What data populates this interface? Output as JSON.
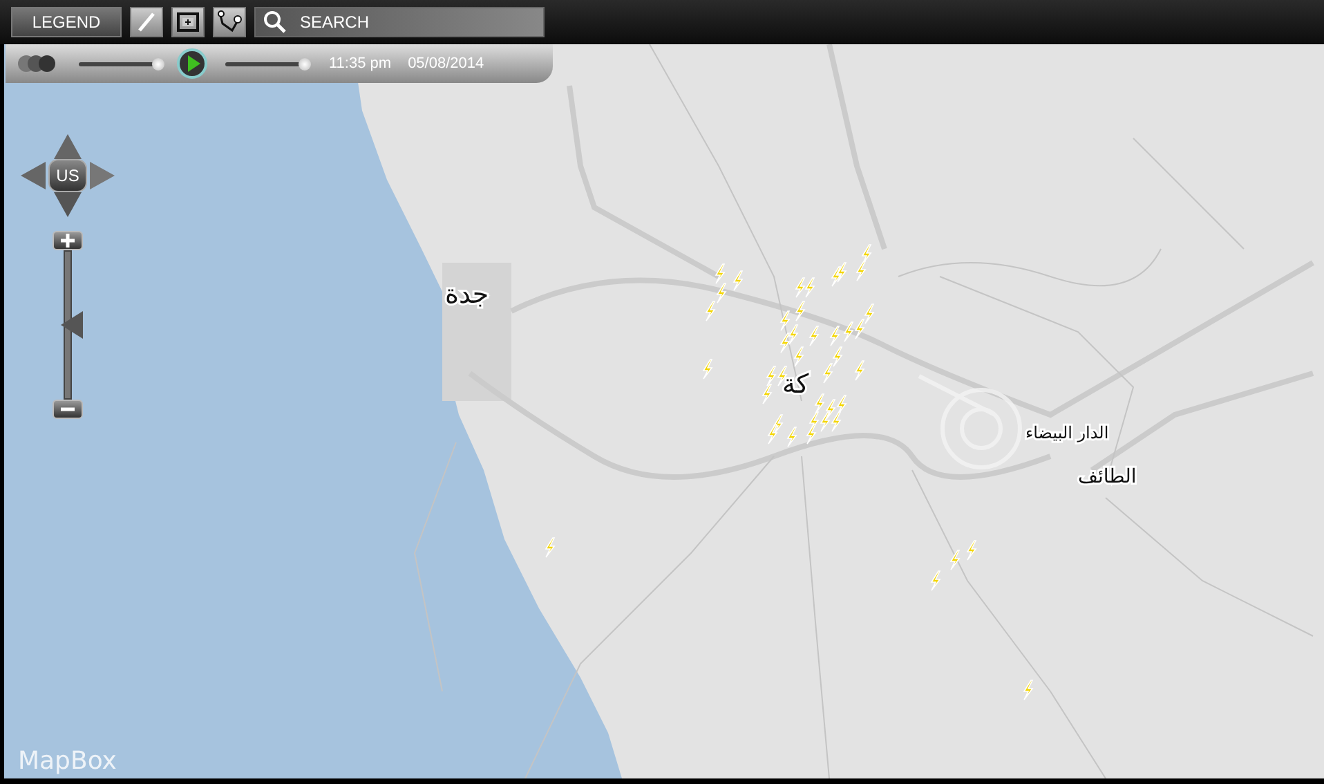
{
  "toolbar": {
    "legend_button": "LEGEND",
    "search": {
      "placeholder": "SEARCH"
    }
  },
  "playback": {
    "history_slider": {
      "level": 1
    },
    "speed_slider": {
      "level": 1
    },
    "time": "11:35 pm",
    "date": "05/08/2014"
  },
  "map_controls": {
    "pan_center": "US",
    "zoom": {
      "level": 0.5
    }
  },
  "map": {
    "places": [
      {
        "name": "جدة"
      },
      {
        "name": "كة"
      },
      {
        "name": "الدار البيضاء"
      },
      {
        "name": "الطائف"
      }
    ],
    "attribution": "MapBox"
  }
}
